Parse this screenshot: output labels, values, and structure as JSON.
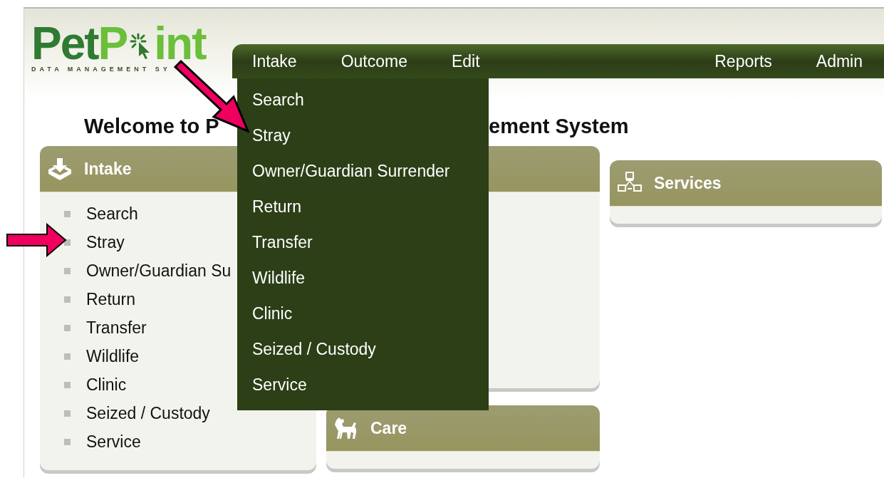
{
  "logo": {
    "dark_part": "Pet",
    "light_part": "P",
    "light_end": "int",
    "tagline": "DATA MANAGEMENT SY"
  },
  "nav": {
    "items": [
      {
        "label": "Intake"
      },
      {
        "label": "Outcome"
      },
      {
        "label": "Edit"
      }
    ],
    "right_items": [
      {
        "label": "Reports"
      },
      {
        "label": "Admin"
      }
    ]
  },
  "dropdown": {
    "items": [
      "Search",
      "Stray",
      "Owner/Guardian Surrender",
      "Return",
      "Transfer",
      "Wildlife",
      "Clinic",
      "Seized / Custody",
      "Service"
    ]
  },
  "heading": {
    "visible_start": "Welcome to P",
    "visible_end": "ement System"
  },
  "panels": {
    "intake": {
      "title": "Intake",
      "items": [
        "Search",
        "Stray",
        "Owner/Guardian Su",
        "Return",
        "Transfer",
        "Wildlife",
        "Clinic",
        "Seized / Custody",
        "Service"
      ]
    },
    "care": {
      "title": "Care"
    },
    "services": {
      "title": "Services"
    }
  }
}
